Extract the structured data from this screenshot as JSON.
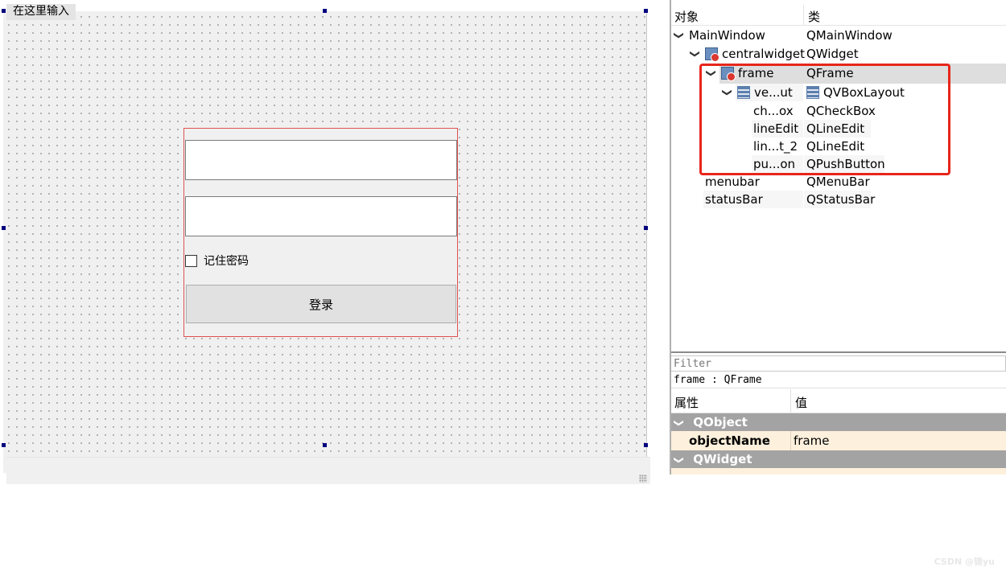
{
  "designer": {
    "menu_placeholder": "在这里输入",
    "frame": {
      "lineedit_1_value": "",
      "lineedit_2_value": "",
      "checkbox_label": "记住密码",
      "checkbox_checked": false,
      "login_button_label": "登录"
    }
  },
  "object_inspector": {
    "header_object": "对象",
    "header_class": "类",
    "rows": [
      {
        "name": "MainWindow",
        "class": "QMainWindow",
        "icon": "none",
        "expanded": true
      },
      {
        "name": "centralwidget",
        "class": "QWidget",
        "icon": "widget-icon",
        "expanded": true
      },
      {
        "name": "frame",
        "class": "QFrame",
        "icon": "widget-icon",
        "expanded": true,
        "selected": true
      },
      {
        "name": "ve...ut",
        "class": "QVBoxLayout",
        "icon": "layout-icon",
        "expanded": true
      },
      {
        "name": "ch...ox",
        "class": "QCheckBox"
      },
      {
        "name": "lineEdit",
        "class": "QLineEdit"
      },
      {
        "name": "lin...t_2",
        "class": "QLineEdit"
      },
      {
        "name": "pu...on",
        "class": "QPushButton"
      },
      {
        "name": "menubar",
        "class": "QMenuBar"
      },
      {
        "name": "statusBar",
        "class": "QStatusBar"
      }
    ],
    "highlight_color": "#e8251b"
  },
  "property_editor": {
    "filter_placeholder": "Filter",
    "object_label": "frame : QFrame",
    "header_property": "属性",
    "header_value": "值",
    "groups": [
      {
        "name": "QObject"
      },
      {
        "name": "QWidget"
      }
    ],
    "object_name_property": "objectName",
    "object_name_value": "frame"
  },
  "watermark": "CSDN @锦yu",
  "colors": {
    "group_header": "#a3a3a3",
    "property_row": "#fdf0dc",
    "frame_border": "#e05050",
    "selection_handle": "#00007f"
  }
}
